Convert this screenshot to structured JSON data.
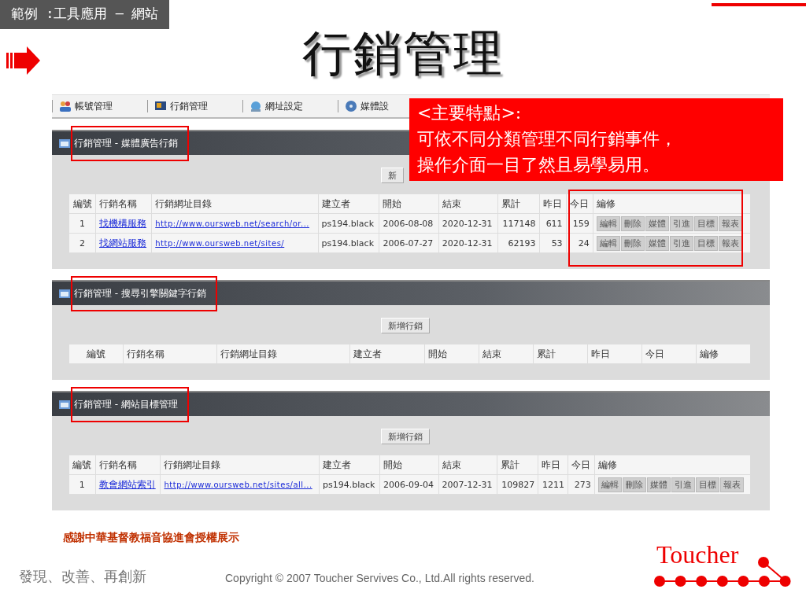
{
  "slide": {
    "tag": "範例 :工具應用 – 網站",
    "title": "行銷管理"
  },
  "menu": [
    {
      "label": "帳號管理"
    },
    {
      "label": "行銷管理"
    },
    {
      "label": "網址設定"
    },
    {
      "label": "媒體設"
    }
  ],
  "callout": {
    "heading": "<主要特點>:",
    "lines": [
      "可依不同分類管理不同行銷事件，",
      "操作介面一目了然且易學易用。"
    ]
  },
  "panels": [
    {
      "title": "行銷管理 - 媒體廣告行銷",
      "title_highlighted": true,
      "edit_highlighted": true,
      "button": "新",
      "columns": [
        "編號",
        "行銷名稱",
        "行銷網址目錄",
        "建立者",
        "開始",
        "結束",
        "累計",
        "昨日",
        "今日",
        "編修"
      ],
      "rows": [
        {
          "no": "1",
          "name": "找機構服務",
          "url": "http://www.oursweb.net/search/or...",
          "creator": "ps194.black",
          "start": "2006-08-08",
          "end": "2020-12-31",
          "total": "117148",
          "yesterday": "611",
          "today": "159",
          "actions": [
            "編輯",
            "刪除",
            "媒體",
            "引進",
            "目標",
            "報表"
          ]
        },
        {
          "no": "2",
          "name": "找網站服務",
          "url": "http://www.oursweb.net/sites/",
          "creator": "ps194.black",
          "start": "2006-07-27",
          "end": "2020-12-31",
          "total": "62193",
          "yesterday": "53",
          "today": "24",
          "actions": [
            "編輯",
            "刪除",
            "媒體",
            "引進",
            "目標",
            "報表"
          ]
        }
      ]
    },
    {
      "title": "行銷管理 - 搜尋引擎關鍵字行銷",
      "title_highlighted": true,
      "edit_highlighted": false,
      "button": "新增行銷",
      "columns": [
        "編號",
        "行銷名稱",
        "行銷網址目錄",
        "建立者",
        "開始",
        "結束",
        "累計",
        "昨日",
        "今日",
        "編修"
      ]
    },
    {
      "title": "行銷管理 - 網站目標管理",
      "title_highlighted": true,
      "edit_highlighted": false,
      "button": "新增行銷",
      "columns": [
        "編號",
        "行銷名稱",
        "行銷網址目錄",
        "建立者",
        "開始",
        "結束",
        "累計",
        "昨日",
        "今日",
        "編修"
      ],
      "rows": [
        {
          "no": "1",
          "name": "教會網站索引",
          "url": "http://www.oursweb.net/sites/all...",
          "creator": "ps194.black",
          "start": "2006-09-04",
          "end": "2007-12-31",
          "total": "109827",
          "yesterday": "1211",
          "today": "273",
          "actions": [
            "編輯",
            "刪除",
            "媒體",
            "引進",
            "目標",
            "報表"
          ]
        }
      ]
    }
  ],
  "footer": {
    "thanks": "感謝中華基督教福音協進會授權展示",
    "slogan": "發現、改善、再創新",
    "copyright": "Copyright © 2007 Toucher Servives Co., Ltd.All rights reserved.",
    "logo": "Toucher"
  }
}
